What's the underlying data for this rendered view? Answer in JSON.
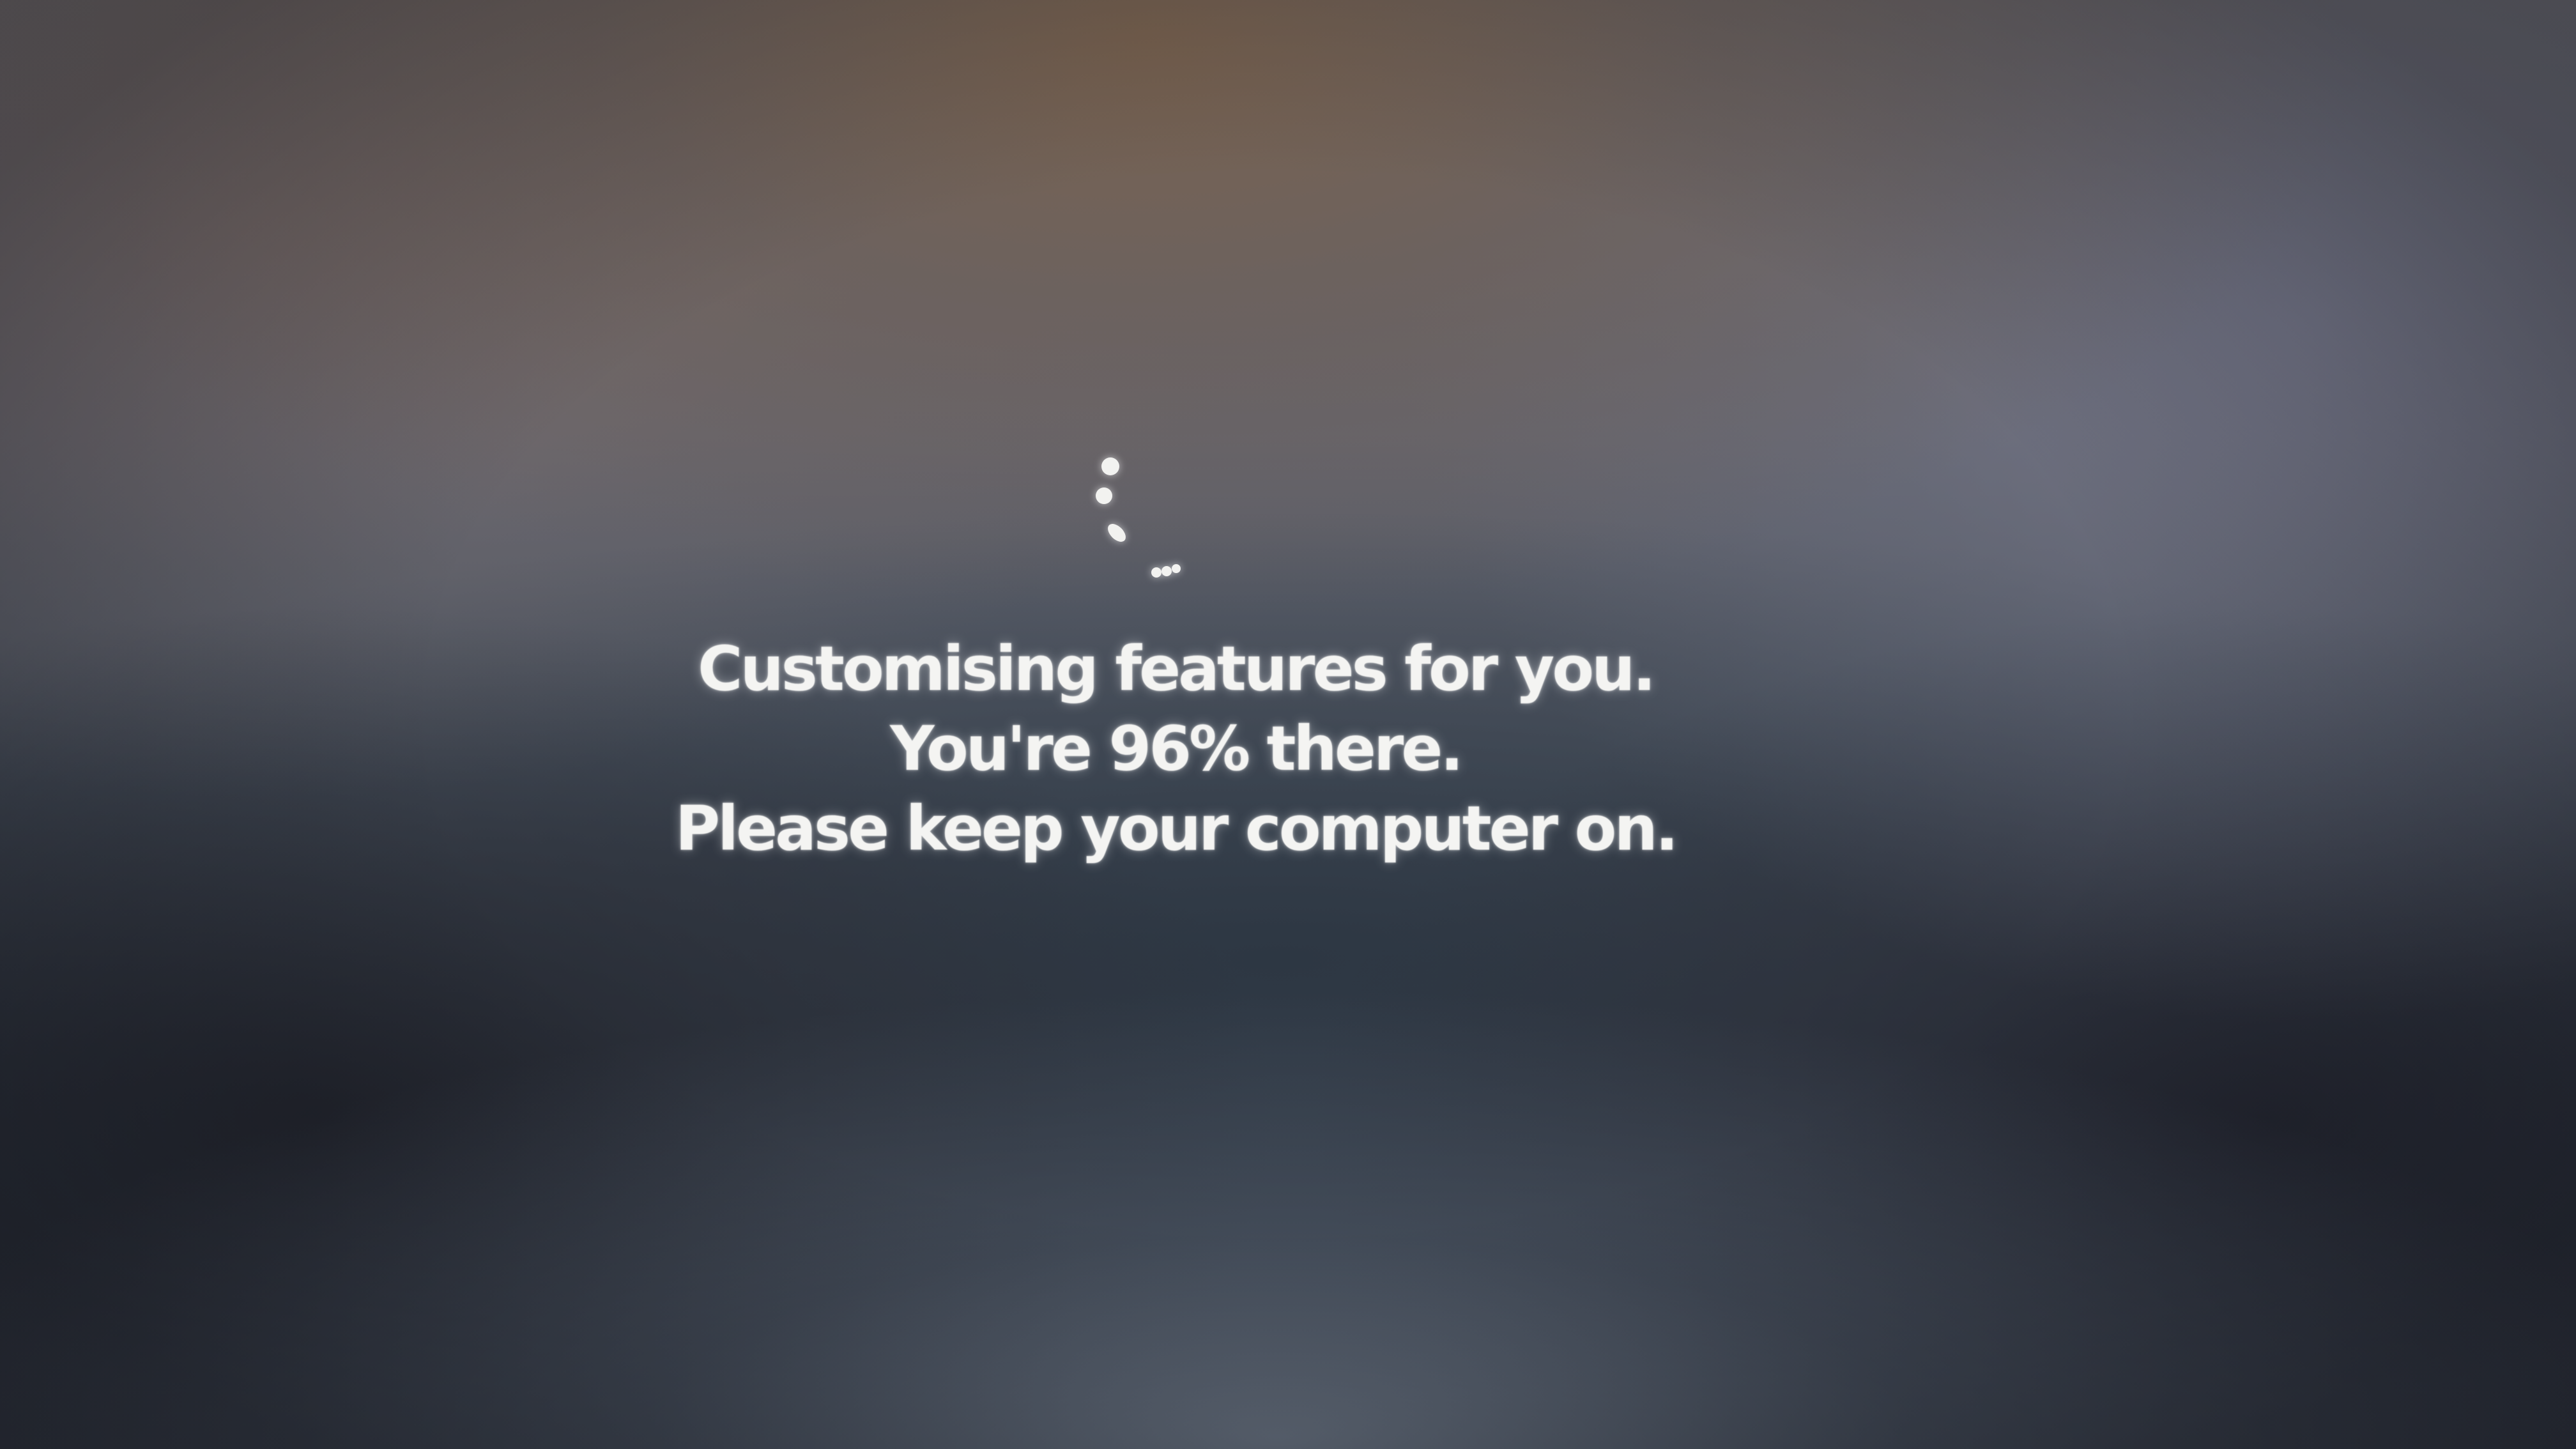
{
  "setup_screen": {
    "line1": "Customising features for you.",
    "line2": "You're 96% there.",
    "line3": "Please keep your computer on.",
    "progress_percent": 96,
    "spinner_icon": "loading-dots-spinner",
    "text_color": "#f4f4f2"
  }
}
